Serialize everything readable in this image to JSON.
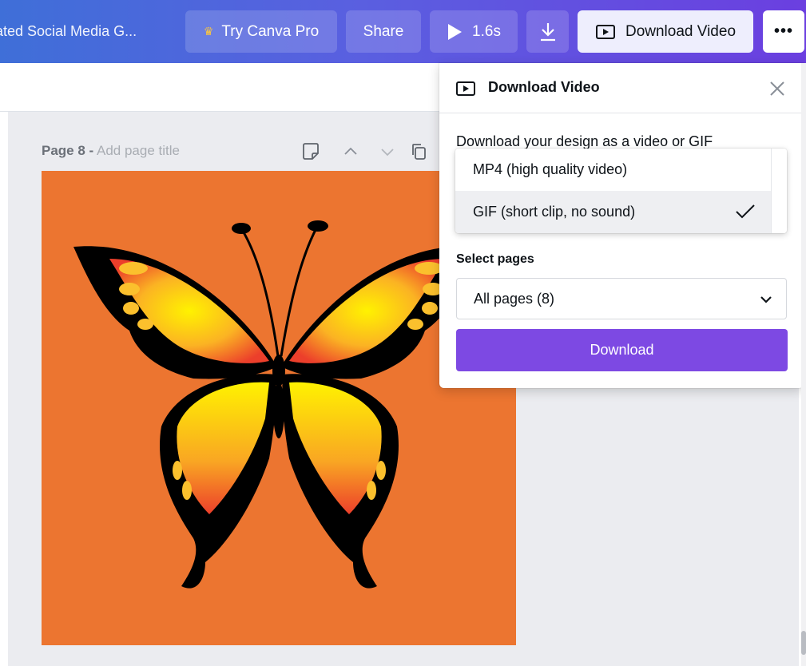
{
  "topbar": {
    "doc_title": "ated Social Media G...",
    "try_pro_label": "Try Canva Pro",
    "share_label": "Share",
    "play_duration": "1.6s",
    "download_video_label": "Download Video",
    "more_label": "•••",
    "colors": {
      "gradient_start": "#3f6fd8",
      "gradient_end": "#6b3fe0",
      "crown": "#ffc83a"
    }
  },
  "page": {
    "page_label": "Page 8 -",
    "title_placeholder": "Add page title",
    "background_color": "#ec7530"
  },
  "panel": {
    "title": "Download Video",
    "description": "Download your design as a video or GIF",
    "format_options": [
      {
        "label": "MP4 (high quality video)",
        "selected": false
      },
      {
        "label": "GIF (short clip, no sound)",
        "selected": true
      }
    ],
    "select_pages_label": "Select pages",
    "pages_value": "All pages (8)",
    "download_button": "Download",
    "colors": {
      "download_button": "#7d49e3"
    }
  },
  "icons": {
    "crown": "crown-icon",
    "play": "play-icon",
    "download": "download-arrow-icon",
    "video": "video-icon",
    "close": "close-icon",
    "check": "checkmark-icon",
    "chevron": "chevron-down-icon",
    "note": "note-icon",
    "copy": "copy-icon"
  }
}
